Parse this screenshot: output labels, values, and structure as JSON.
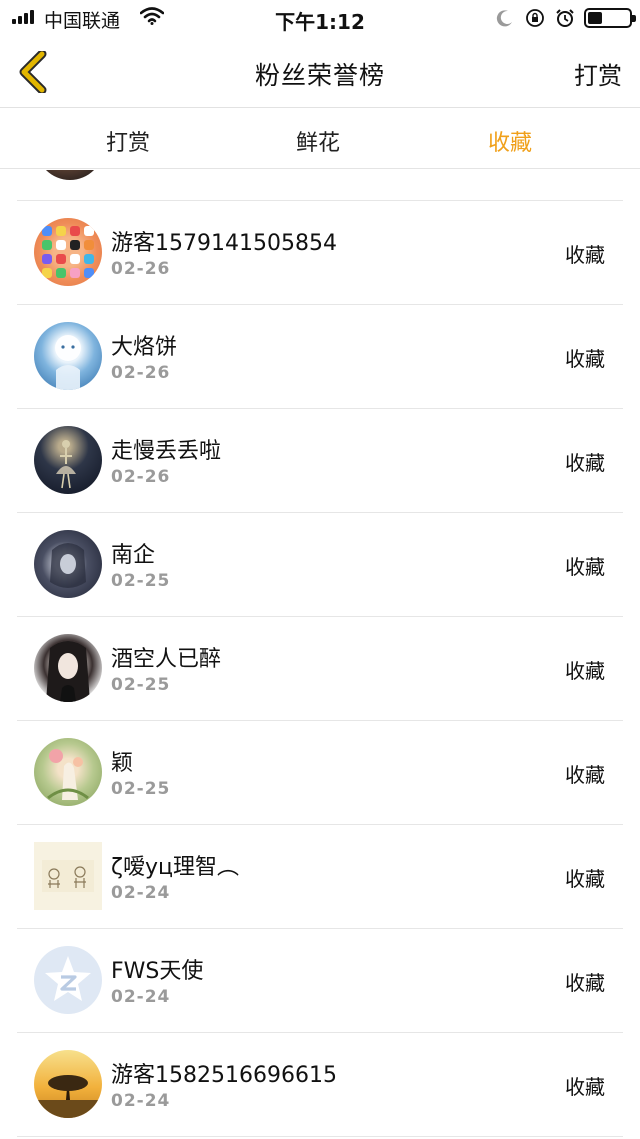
{
  "status_bar": {
    "carrier": "中国联通",
    "time": "下午1:12",
    "battery_level": 0.35,
    "icons": [
      "signal-icon",
      "wifi-icon",
      "moon-icon",
      "orientation-lock-icon",
      "alarm-icon",
      "battery-icon"
    ]
  },
  "nav": {
    "back_icon": "chevron-left-icon",
    "title": "粉丝荣誉榜",
    "right_label": "打赏"
  },
  "tabs": [
    {
      "label": "打赏",
      "active": false
    },
    {
      "label": "鲜花",
      "active": false
    },
    {
      "label": "收藏",
      "active": true
    }
  ],
  "colors": {
    "accent": "#f0a01a",
    "back_icon_stroke": "#e2b600",
    "date_text": "#9a9a9a",
    "divider": "#e6e6e6"
  },
  "list": [
    {
      "name": "游客1579141505854",
      "date": "02-26",
      "action": "收藏",
      "avatar": "app-icons-avatar"
    },
    {
      "name": "大烙饼",
      "date": "02-26",
      "action": "收藏",
      "avatar": "moon-child-avatar"
    },
    {
      "name": "走慢丢丢啦",
      "date": "02-26",
      "action": "收藏",
      "avatar": "dancer-avatar"
    },
    {
      "name": "南企",
      "date": "02-25",
      "action": "收藏",
      "avatar": "dark-figure-avatar"
    },
    {
      "name": "酒空人已醉",
      "date": "02-25",
      "action": "收藏",
      "avatar": "girl-portrait-avatar"
    },
    {
      "name": "颖",
      "date": "02-25",
      "action": "收藏",
      "avatar": "flower-girl-avatar"
    },
    {
      "name": "ζ嗳yц理智︵",
      "date": "02-24",
      "action": "收藏",
      "avatar": "sketch-kids-avatar"
    },
    {
      "name": "FWS天使",
      "date": "02-24",
      "action": "收藏",
      "avatar": "default-star-avatar"
    },
    {
      "name": "游客1582516696615",
      "date": "02-24",
      "action": "收藏",
      "avatar": "sunset-tree-avatar"
    }
  ]
}
